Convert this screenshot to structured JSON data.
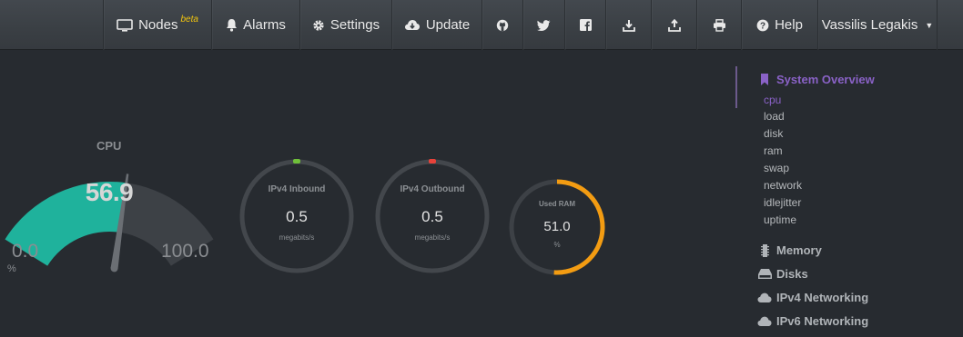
{
  "nav": {
    "nodes_label": "Nodes",
    "nodes_badge": "beta",
    "alarms_label": "Alarms",
    "settings_label": "Settings",
    "update_label": "Update",
    "help_label": "Help",
    "user_label": "Vassilis Legakis",
    "icons": [
      "github-icon",
      "twitter-icon",
      "facebook-icon",
      "download-icon",
      "upload-icon",
      "print-icon"
    ]
  },
  "cpu_gauge": {
    "title": "CPU",
    "value": "56.9",
    "min": "0.0",
    "max": "100.0",
    "unit": "%",
    "fraction": 0.569,
    "fill_color": "#1fb29c",
    "track_color": "#3d4146"
  },
  "pies": {
    "ipv4_in": {
      "title": "IPv4 Inbound",
      "value": "0.5",
      "unit": "megabits/s",
      "fraction": 0,
      "marker_color": "#6fbf3a"
    },
    "ipv4_out": {
      "title": "IPv4 Outbound",
      "value": "0.5",
      "unit": "megabits/s",
      "fraction": 0,
      "marker_color": "#e8423a"
    },
    "ram": {
      "title": "Used RAM",
      "value": "51.0",
      "unit": "%",
      "fraction": 0.51,
      "color": "#f39c12"
    }
  },
  "sidebar": {
    "system_overview": "System Overview",
    "items": [
      "cpu",
      "load",
      "disk",
      "ram",
      "swap",
      "network",
      "idlejitter",
      "uptime"
    ],
    "memory": "Memory",
    "disks": "Disks",
    "ipv4": "IPv4 Networking",
    "ipv6": "IPv6 Networking",
    "accent_color": "#8a62c7"
  }
}
